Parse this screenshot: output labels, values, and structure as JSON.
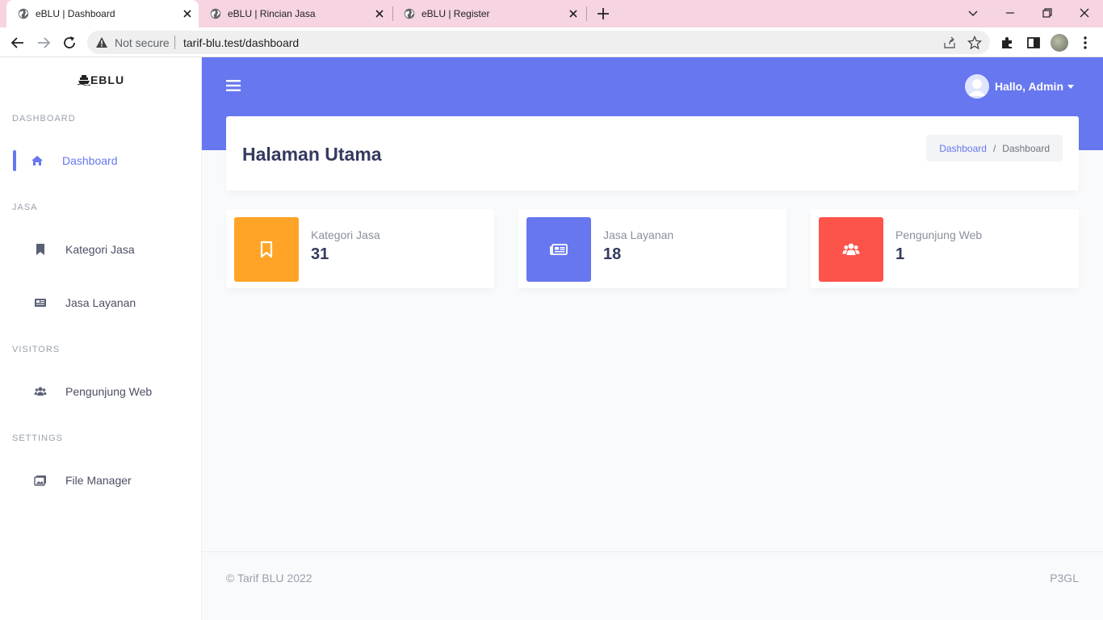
{
  "browser": {
    "tabs": [
      {
        "title": "eBLU | Dashboard",
        "active": true
      },
      {
        "title": "eBLU | Rincian Jasa",
        "active": false
      },
      {
        "title": "eBLU | Register",
        "active": false
      }
    ],
    "security_label": "Not secure",
    "url": "tarif-blu.test/dashboard",
    "colors": {
      "tabbar": "#f6d4e2"
    }
  },
  "sidebar": {
    "brand": "EBLU",
    "sections": [
      {
        "heading": "DASHBOARD",
        "items": [
          {
            "label": "Dashboard",
            "icon": "home-icon",
            "active": true
          }
        ]
      },
      {
        "heading": "JASA",
        "items": [
          {
            "label": "Kategori Jasa",
            "icon": "bookmark-icon"
          },
          {
            "label": "Jasa Layanan",
            "icon": "newspaper-icon"
          }
        ]
      },
      {
        "heading": "VISITORS",
        "items": [
          {
            "label": "Pengunjung Web",
            "icon": "users-icon"
          }
        ]
      },
      {
        "heading": "SETTINGS",
        "items": [
          {
            "label": "File Manager",
            "icon": "images-icon"
          }
        ]
      }
    ]
  },
  "topbar": {
    "user_label": "Hallo, Admin"
  },
  "header": {
    "title": "Halaman Utama",
    "breadcrumb": {
      "link": "Dashboard",
      "current": "Dashboard"
    }
  },
  "stats": [
    {
      "label": "Kategori Jasa",
      "value": "31",
      "color": "#ffa426",
      "icon": "bookmark-icon"
    },
    {
      "label": "Jasa Layanan",
      "value": "18",
      "color": "#6777ef",
      "icon": "newspaper-icon"
    },
    {
      "label": "Pengunjung Web",
      "value": "1",
      "color": "#fc544b",
      "icon": "users-icon"
    }
  ],
  "footer": {
    "copyright": "© Tarif BLU 2022",
    "right": "P3GL"
  },
  "colors": {
    "primary": "#6777ef",
    "warning": "#ffa426",
    "danger": "#fc544b"
  }
}
